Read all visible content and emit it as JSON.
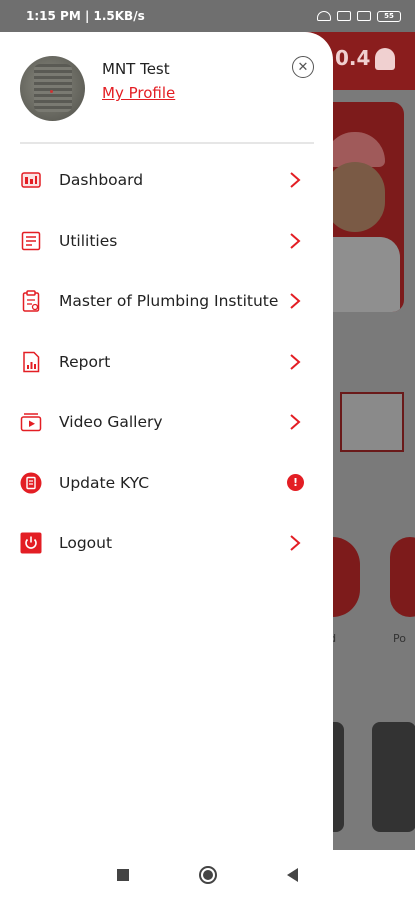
{
  "status_bar": {
    "time": "1:15 PM | 1.5KB/s",
    "battery": "55"
  },
  "background": {
    "version_text": "0.4",
    "label_1": "ard",
    "label_2": "Po"
  },
  "drawer": {
    "user_name": "MNT Test",
    "profile_link": "My Profile",
    "close_symbol": "✕",
    "menu": [
      {
        "label": "Dashboard",
        "icon": "dashboard-icon",
        "trailing": "chevron"
      },
      {
        "label": "Utilities",
        "icon": "utilities-icon",
        "trailing": "chevron"
      },
      {
        "label": "Master of Plumbing Institute",
        "icon": "clipboard-icon",
        "trailing": "chevron"
      },
      {
        "label": "Report",
        "icon": "report-icon",
        "trailing": "chevron"
      },
      {
        "label": "Video Gallery",
        "icon": "video-gallery-icon",
        "trailing": "chevron"
      },
      {
        "label": "Update KYC",
        "icon": "kyc-icon",
        "trailing": "alert"
      },
      {
        "label": "Logout",
        "icon": "logout-icon",
        "trailing": "chevron"
      }
    ],
    "alert_symbol": "!"
  },
  "colors": {
    "accent": "#e31e24",
    "text": "#222222",
    "overlay": "#6b6b6b"
  }
}
